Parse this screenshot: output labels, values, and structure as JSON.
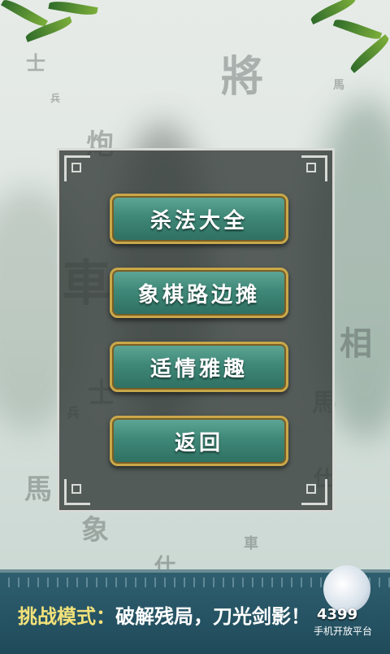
{
  "background_pieces": [
    "士",
    "兵",
    "將",
    "馬",
    "炮",
    "車",
    "士",
    "兵",
    "馬",
    "象",
    "仕",
    "車",
    "仕",
    "相",
    "馬"
  ],
  "menu": {
    "buttons": [
      {
        "label": "杀法大全"
      },
      {
        "label": "象棋路边摊"
      },
      {
        "label": "适情雅趣"
      },
      {
        "label": "返回"
      }
    ]
  },
  "footer": {
    "label": "挑战模式：",
    "message": "破解残局，刀光剑影！",
    "platform_number": "4399",
    "platform_name": "手机开放平台"
  },
  "colors": {
    "button_top": "#5fa797",
    "button_bottom": "#2e6f61",
    "button_border": "#c9a84a",
    "ticker_label": "#f3e27a",
    "bar": "#2f5f6f"
  }
}
